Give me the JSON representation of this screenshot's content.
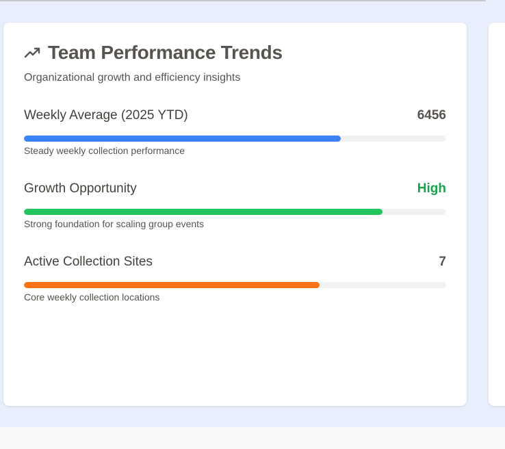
{
  "colors": {
    "page_bg": "#e8eefc",
    "card_bg": "#ffffff",
    "title": "#57534e",
    "blue": "#3b82f6",
    "green": "#22c55e",
    "green_text": "#16a34a",
    "orange": "#f97316",
    "track": "#f1f2f4"
  },
  "card": {
    "icon": "trending-up-icon",
    "title": "Team Performance Trends",
    "subtitle": "Organizational growth and efficiency insights"
  },
  "metrics": [
    {
      "label": "Weekly Average (2025 YTD)",
      "value": "6456",
      "description": "Steady weekly collection performance",
      "progress_pct": 75,
      "color": "#3b82f6"
    },
    {
      "label": "Growth Opportunity",
      "value": "High",
      "description": "Strong foundation for scaling group events",
      "progress_pct": 85,
      "color": "#22c55e"
    },
    {
      "label": "Active Collection Sites",
      "value": "7",
      "description": "Core weekly collection locations",
      "progress_pct": 70,
      "color": "#f97316"
    }
  ]
}
